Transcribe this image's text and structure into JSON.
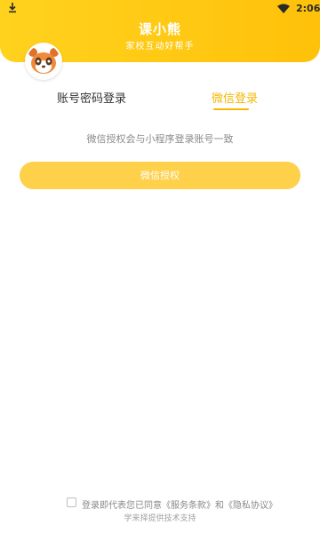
{
  "status_bar": {
    "time": "2:06",
    "download_icon": "download-icon",
    "wifi_icon": "wifi-icon",
    "battery_icon": "battery-icon"
  },
  "header": {
    "title": "课小熊",
    "subtitle": "家校互动好帮手",
    "avatar_icon": "panda-logo-icon",
    "color": "#FFC10A"
  },
  "tabs": [
    {
      "label": "账号密码登录",
      "active": false
    },
    {
      "label": "微信登录",
      "active": true
    }
  ],
  "wechat": {
    "hint": "微信授权会与小程序登录账号一致",
    "button_label": "微信授权",
    "button_color": "#FFD04A"
  },
  "agreement": {
    "prefix": "登录即代表您已同意",
    "service_link": "《服务条款》",
    "and": "和",
    "privacy_link": "《隐私协议》"
  },
  "footer": {
    "text": "学来择提供技术支持"
  }
}
